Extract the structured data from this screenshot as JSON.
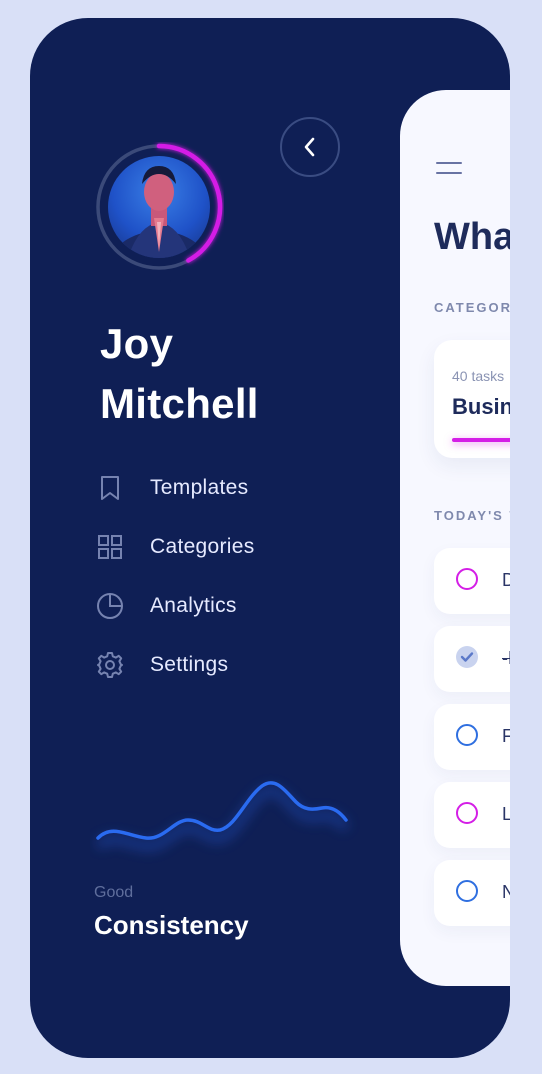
{
  "profile": {
    "first_name": "Joy",
    "last_name": "Mitchell",
    "progress_fraction": 0.42
  },
  "menu": [
    {
      "label": "Templates",
      "icon": "bookmark-icon"
    },
    {
      "label": "Categories",
      "icon": "grid-icon"
    },
    {
      "label": "Analytics",
      "icon": "pie-chart-icon"
    },
    {
      "label": "Settings",
      "icon": "gear-icon"
    }
  ],
  "consistency": {
    "label": "Good",
    "title": "Consistency"
  },
  "panel": {
    "title": "Wha",
    "categories_label": "CATEGORI",
    "category_card": {
      "tasks": "40 tasks",
      "name": "Busin"
    },
    "today_label": "TODAY'S T",
    "tasks": [
      {
        "text": "D",
        "status": "pending",
        "color": "#d41ee6"
      },
      {
        "text": "-F",
        "status": "done",
        "color": "#c9d3ef"
      },
      {
        "text": "F",
        "status": "pending",
        "color": "#2f6fe0"
      },
      {
        "text": "L",
        "status": "pending",
        "color": "#d41ee6"
      },
      {
        "text": "N",
        "status": "pending",
        "color": "#2f6fe0"
      }
    ]
  },
  "colors": {
    "background": "#d9e0f7",
    "sidebar": "#0f1f55",
    "accent_pink": "#d41ee6",
    "accent_blue": "#2f6fe0",
    "panel": "#f7f8ff"
  }
}
